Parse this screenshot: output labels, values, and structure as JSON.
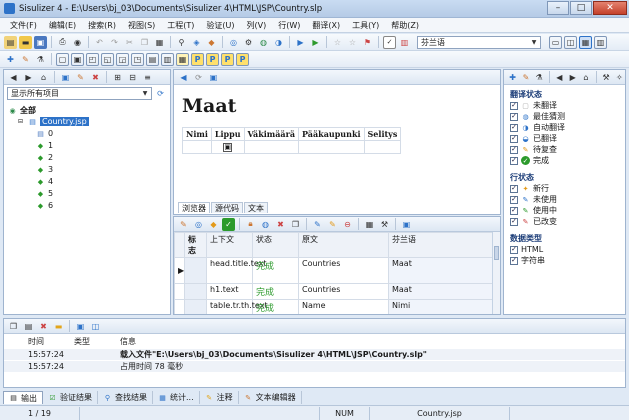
{
  "window": {
    "title": "Sisulizer 4 - E:\\Users\\bj_03\\Documents\\Sisulizer 4\\HTML\\JSP\\Country.slp",
    "controls": [
      "–",
      "□",
      "✕"
    ]
  },
  "menu": [
    "文件(F)",
    "编辑(E)",
    "搜索(R)",
    "视图(S)",
    "工程(T)",
    "验证(U)",
    "列(V)",
    "行(W)",
    "翻译(X)",
    "工具(Y)",
    "帮助(Z)"
  ],
  "toolbar": {
    "language_combo": "芬兰语"
  },
  "tree_panel": {
    "filter_combo": "显示所有项目",
    "root": "全部",
    "file": "Country.jsp",
    "rows": [
      "0",
      "1",
      "2",
      "3",
      "4",
      "5",
      "6"
    ]
  },
  "preview": {
    "heading": "Maat",
    "headers": [
      "Nimi",
      "Lippu",
      "Väkimäärä",
      "Pääkaupunki",
      "Selitys"
    ],
    "tabs": [
      "浏览器",
      "源代码",
      "文本"
    ]
  },
  "grid": {
    "columns": [
      "标志",
      "上下文",
      "状态",
      "原文",
      "芬兰语"
    ],
    "rows": [
      {
        "context": "head.title.text",
        "status": "完成",
        "original": "Countries",
        "translation": "Maat"
      },
      {
        "context": "h1.text",
        "status": "完成",
        "original": "Countries",
        "translation": "Maat"
      },
      {
        "context": "table.tr.th.text",
        "status": "完成",
        "original": "Name",
        "translation": "Nimi"
      }
    ]
  },
  "status_panel": {
    "translate_title": "翻译状态",
    "translate_items": [
      "未翻译",
      "最佳猜测",
      "自动翻译",
      "已翻译",
      "待复查",
      "完成"
    ],
    "row_title": "行状态",
    "row_items": [
      "新行",
      "未使用",
      "使用中",
      "已改变"
    ],
    "data_title": "数据类型",
    "data_items": [
      "HTML",
      "字符串"
    ]
  },
  "log": {
    "columns": [
      "时间",
      "类型",
      "信息"
    ],
    "rows": [
      {
        "time": "15:57:24",
        "type": "",
        "info": "载入文件\"E:\\Users\\bj_03\\Documents\\Sisulizer 4\\HTML\\JSP\\Country.slp\"",
        "bold": true
      },
      {
        "time": "15:57:24",
        "type": "",
        "info": "占用时间 78 毫秒",
        "bold": false
      }
    ]
  },
  "bottom_tabs": [
    "输出",
    "验证结果",
    "查找结果",
    "统计...",
    "注释",
    "文本编辑器"
  ],
  "statusbar": {
    "page": "1 / 19",
    "num": "NUM",
    "file": "Country.jsp"
  },
  "colors": {
    "accent": "#2d72c8",
    "complete": "#2c9a2c",
    "panel_bg": "#dfe9f5"
  }
}
